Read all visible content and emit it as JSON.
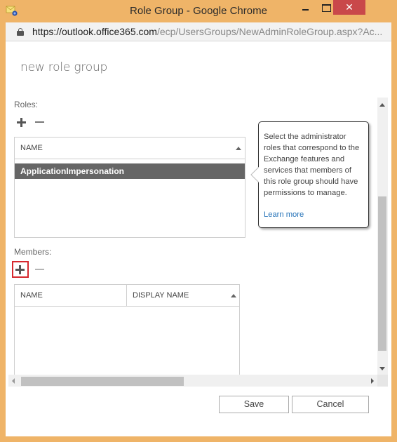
{
  "window": {
    "title": "Role Group - Google Chrome",
    "close_glyph": "✕"
  },
  "addressbar": {
    "url_host": "https://outlook.office365.com",
    "url_path": "/ecp/UsersGroups/NewAdminRoleGroup.aspx?Ac..."
  },
  "page": {
    "title": "new role group"
  },
  "roles": {
    "label": "Roles:",
    "columns": [
      "NAME"
    ],
    "rows": [
      {
        "name": "ApplicationImpersonation",
        "selected": true
      }
    ]
  },
  "callout": {
    "text": "Select the administrator roles that correspond to the Exchange features and services that members of this role group should have permissions to manage.",
    "link_label": "Learn more"
  },
  "members": {
    "label": "Members:",
    "columns": [
      "NAME",
      "DISPLAY NAME"
    ],
    "rows": []
  },
  "footer": {
    "save_label": "Save",
    "cancel_label": "Cancel"
  },
  "colors": {
    "window_frame": "#efb468",
    "close_button": "#c9484a",
    "selected_row": "#666666",
    "link": "#2472b8",
    "highlight": "#d6282e"
  }
}
